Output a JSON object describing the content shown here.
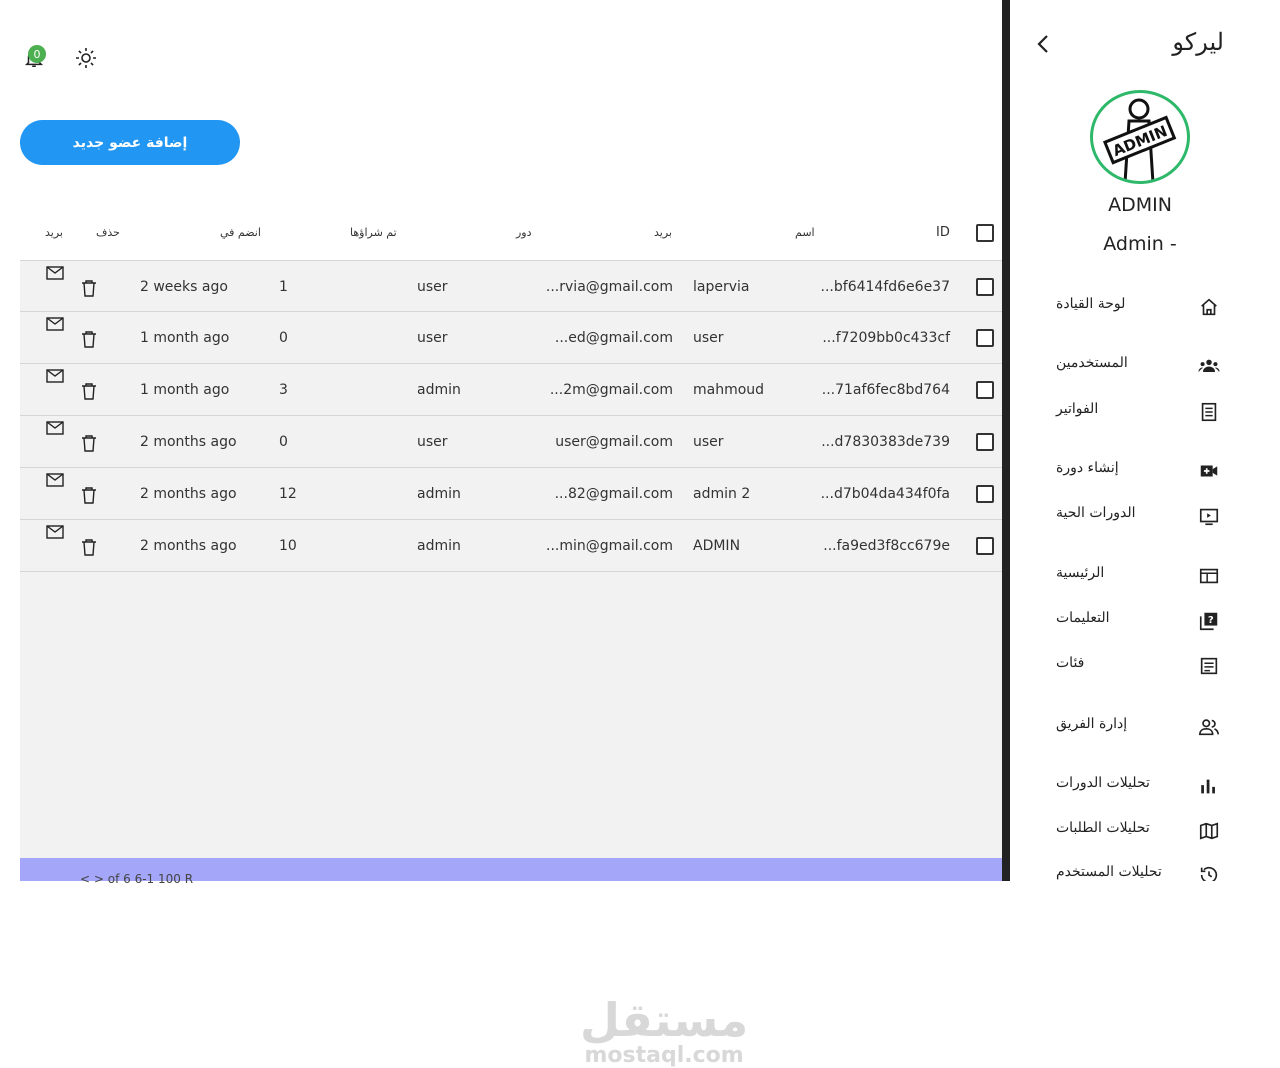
{
  "topbar": {
    "notification_count": "0"
  },
  "actions": {
    "add_member": "إضافة عضو جديد"
  },
  "table": {
    "headers": {
      "id": "ID",
      "name": "اسم",
      "email": "بريد",
      "role": "دور",
      "purchased": "تم شراؤها",
      "joined": "انضم في",
      "delete": "حذف",
      "mail": "بريد"
    },
    "rows": [
      {
        "id": "...bf6414fd6e6e37",
        "name": "lapervia",
        "email": "...rvia@gmail.com",
        "role": "user",
        "purchased": "1",
        "joined": "2 weeks ago"
      },
      {
        "id": "...f7209bb0c433cf",
        "name": "user",
        "email": "...ed@gmail.com",
        "role": "user",
        "purchased": "0",
        "joined": "1 month ago"
      },
      {
        "id": "...71af6fec8bd764",
        "name": "mahmoud",
        "email": "...2m@gmail.com",
        "role": "admin",
        "purchased": "3",
        "joined": "1 month ago"
      },
      {
        "id": "...d7830383de739",
        "name": "user",
        "email": "user@gmail.com",
        "role": "user",
        "purchased": "0",
        "joined": "2 months ago"
      },
      {
        "id": "...d7b04da434f0fa",
        "name": "admin 2",
        "email": "...82@gmail.com",
        "role": "admin",
        "purchased": "12",
        "joined": "2 months ago"
      },
      {
        "id": "...fa9ed3f8cc679e",
        "name": "ADMIN",
        "email": "...min@gmail.com",
        "role": "admin",
        "purchased": "10",
        "joined": "2 months ago"
      }
    ]
  },
  "pagination": {
    "text": "< > of 6 6-1 100 R"
  },
  "watermark": {
    "line1": "مستقل",
    "line2": "mostaql.com"
  },
  "sidebar": {
    "brand": "ليركو",
    "avatar_text": "ADMIN",
    "username": "ADMIN",
    "role": "Admin -",
    "items": [
      {
        "label": "لوحة القيادة",
        "icon": "home-icon"
      },
      {
        "label": "المستخدمين",
        "icon": "group-icon"
      },
      {
        "label": "الفواتير",
        "icon": "receipt-icon"
      },
      {
        "label": "إنشاء دورة",
        "icon": "video-add-icon"
      },
      {
        "label": "الدورات الحية",
        "icon": "live-tv-icon"
      },
      {
        "label": "الرئيسية",
        "icon": "web-icon"
      },
      {
        "label": "التعليمات",
        "icon": "help-library-icon"
      },
      {
        "label": "فئات",
        "icon": "category-icon"
      },
      {
        "label": "إدارة الفريق",
        "icon": "team-icon"
      },
      {
        "label": "تحليلات الدورات",
        "icon": "bar-chart-icon"
      },
      {
        "label": "تحليلات الطلبات",
        "icon": "map-icon"
      },
      {
        "label": "تحليلات المستخدم",
        "icon": "history-icon"
      }
    ]
  }
}
